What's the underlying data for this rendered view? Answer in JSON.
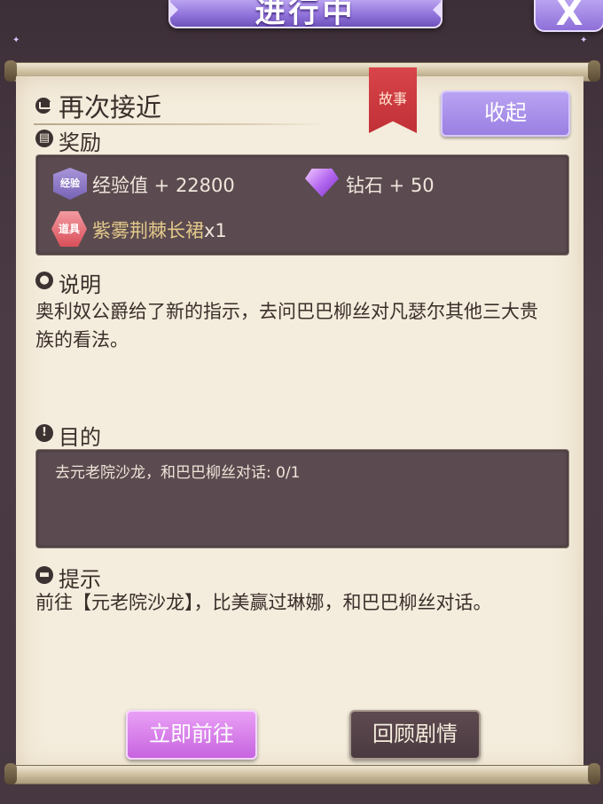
{
  "header": {
    "title": "进行中",
    "close_label": "X"
  },
  "quest": {
    "title": "再次接近",
    "tag": "故事",
    "collapse_label": "收起"
  },
  "rewards": {
    "label": "奖励",
    "exp_badge": "经验",
    "exp_text": "经验值 + 22800",
    "diamond_text": "钻石 + 50",
    "item_badge": "道具",
    "item_name": "紫雾荆棘长裙",
    "item_count": "x1"
  },
  "description": {
    "label": "说明",
    "line1": "奥利奴公爵给了新的指示，去问巴巴柳丝对凡瑟尔其他三大贵",
    "line2": "族的看法。"
  },
  "objective": {
    "label": "目的",
    "text": "去元老院沙龙，和巴巴柳丝对话: 0/1"
  },
  "hint": {
    "label": "提示",
    "text": "前往【元老院沙龙】，比美赢过琳娜，和巴巴柳丝对话。"
  },
  "actions": {
    "go_label": "立即前往",
    "review_label": "回顾剧情"
  },
  "colors": {
    "accent_purple": "#9a7fe2",
    "ribbon_red": "#c03036",
    "item_gold": "#e3c98a",
    "paper": "#f4ecdc"
  },
  "icons": [
    "crown-icon",
    "book-icon",
    "chat-icon",
    "exclamation-icon",
    "note-icon",
    "diamond-icon",
    "close-icon"
  ]
}
